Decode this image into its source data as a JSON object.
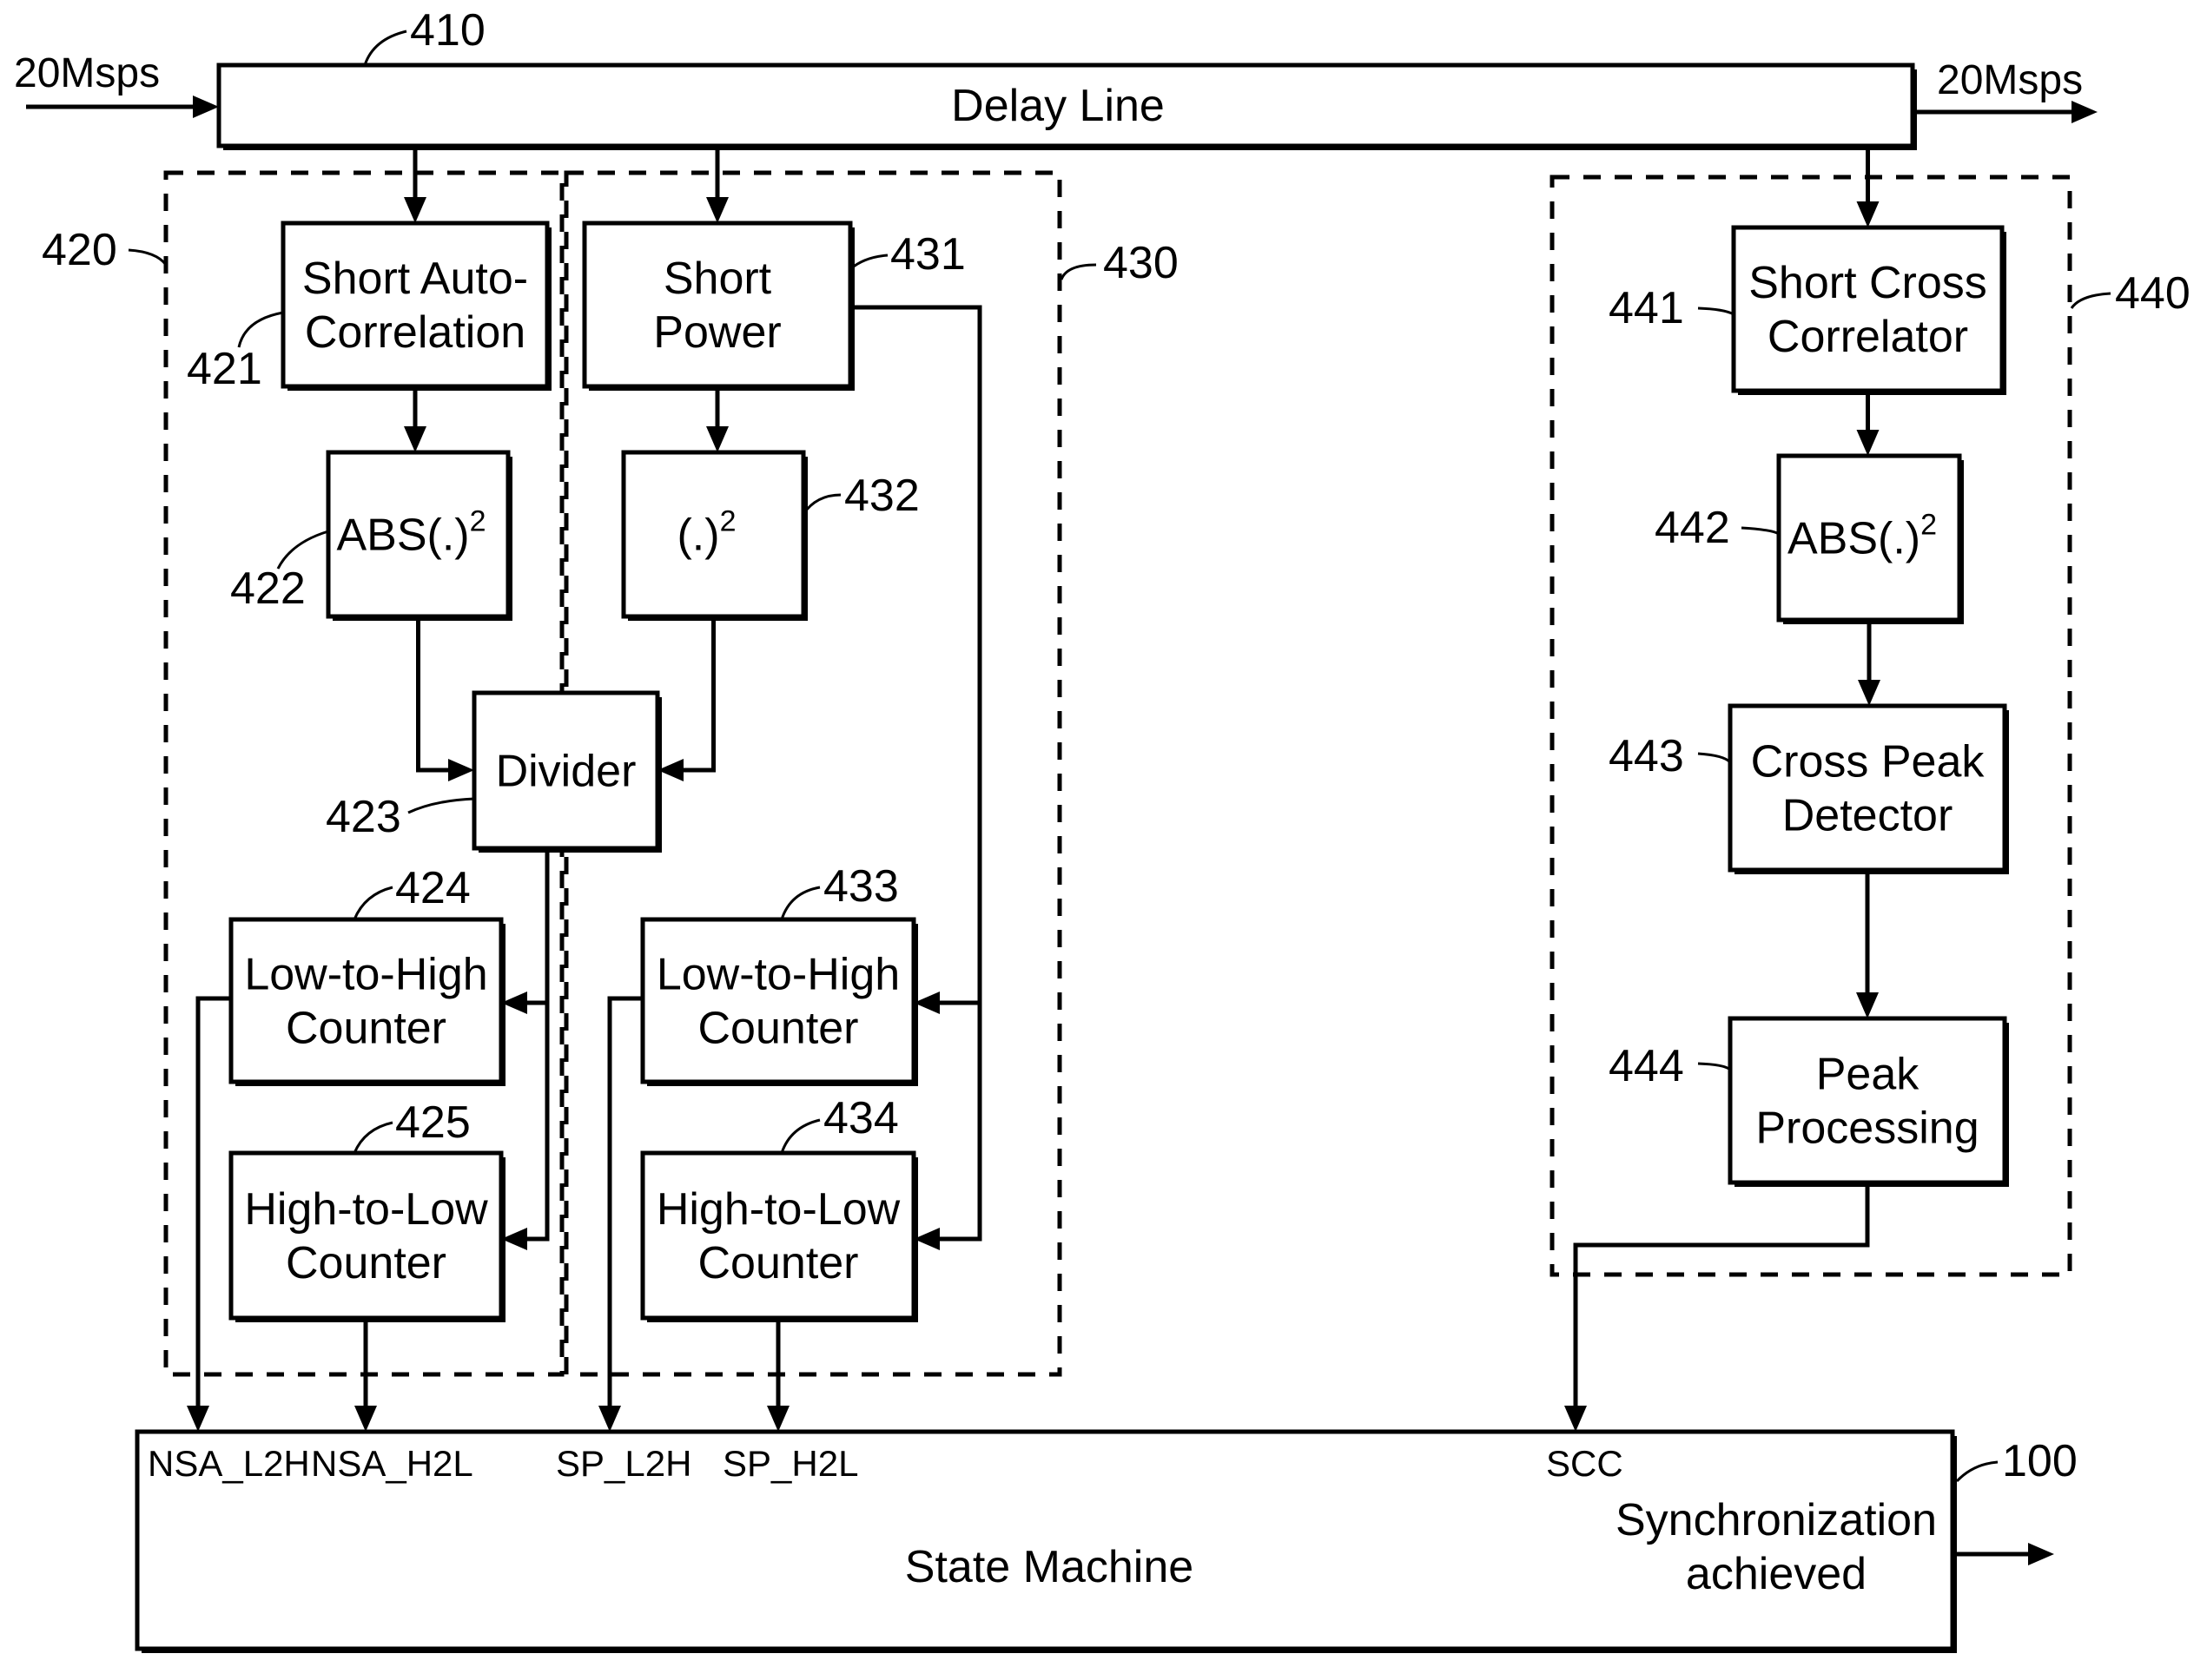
{
  "figure": {
    "delay_line": {
      "ref": "410",
      "label": "Delay Line"
    },
    "input_rate": "20Msps",
    "output_rate": "20Msps",
    "groups": [
      {
        "ref": "420"
      },
      {
        "ref": "430"
      },
      {
        "ref": "440"
      }
    ],
    "blocks": {
      "short_auto_correlation": {
        "ref": "421",
        "lines": [
          "Short Auto-",
          "Correlation"
        ]
      },
      "abs_squared_422": {
        "ref": "422",
        "base": "ABS(.)",
        "sup": "2"
      },
      "divider": {
        "ref": "423",
        "lines": [
          "Divider"
        ]
      },
      "l2h_counter_424": {
        "ref": "424",
        "lines": [
          "Low-to-High",
          "Counter"
        ]
      },
      "h2l_counter_425": {
        "ref": "425",
        "lines": [
          "High-to-Low",
          "Counter"
        ]
      },
      "short_power": {
        "ref": "431",
        "lines": [
          "Short",
          "Power"
        ]
      },
      "squared_432": {
        "ref": "432",
        "base": "(.)",
        "sup": "2"
      },
      "l2h_counter_433": {
        "ref": "433",
        "lines": [
          "Low-to-High",
          "Counter"
        ]
      },
      "h2l_counter_434": {
        "ref": "434",
        "lines": [
          "High-to-Low",
          "Counter"
        ]
      },
      "short_cross_correlator": {
        "ref": "441",
        "lines": [
          "Short Cross",
          "Correlator"
        ]
      },
      "abs_squared_442": {
        "ref": "442",
        "base": "ABS(.)",
        "sup": "2"
      },
      "cross_peak_detector": {
        "ref": "443",
        "lines": [
          "Cross Peak",
          "Detector"
        ]
      },
      "peak_processing": {
        "ref": "444",
        "lines": [
          "Peak",
          "Processing"
        ]
      }
    },
    "state_machine": {
      "ref": "100",
      "label": "State Machine",
      "inputs": [
        "NSA_L2H",
        "NSA_H2L",
        "SP_L2H",
        "SP_H2L",
        "SCC"
      ],
      "output_lines": [
        "Synchronization",
        "achieved"
      ]
    }
  }
}
